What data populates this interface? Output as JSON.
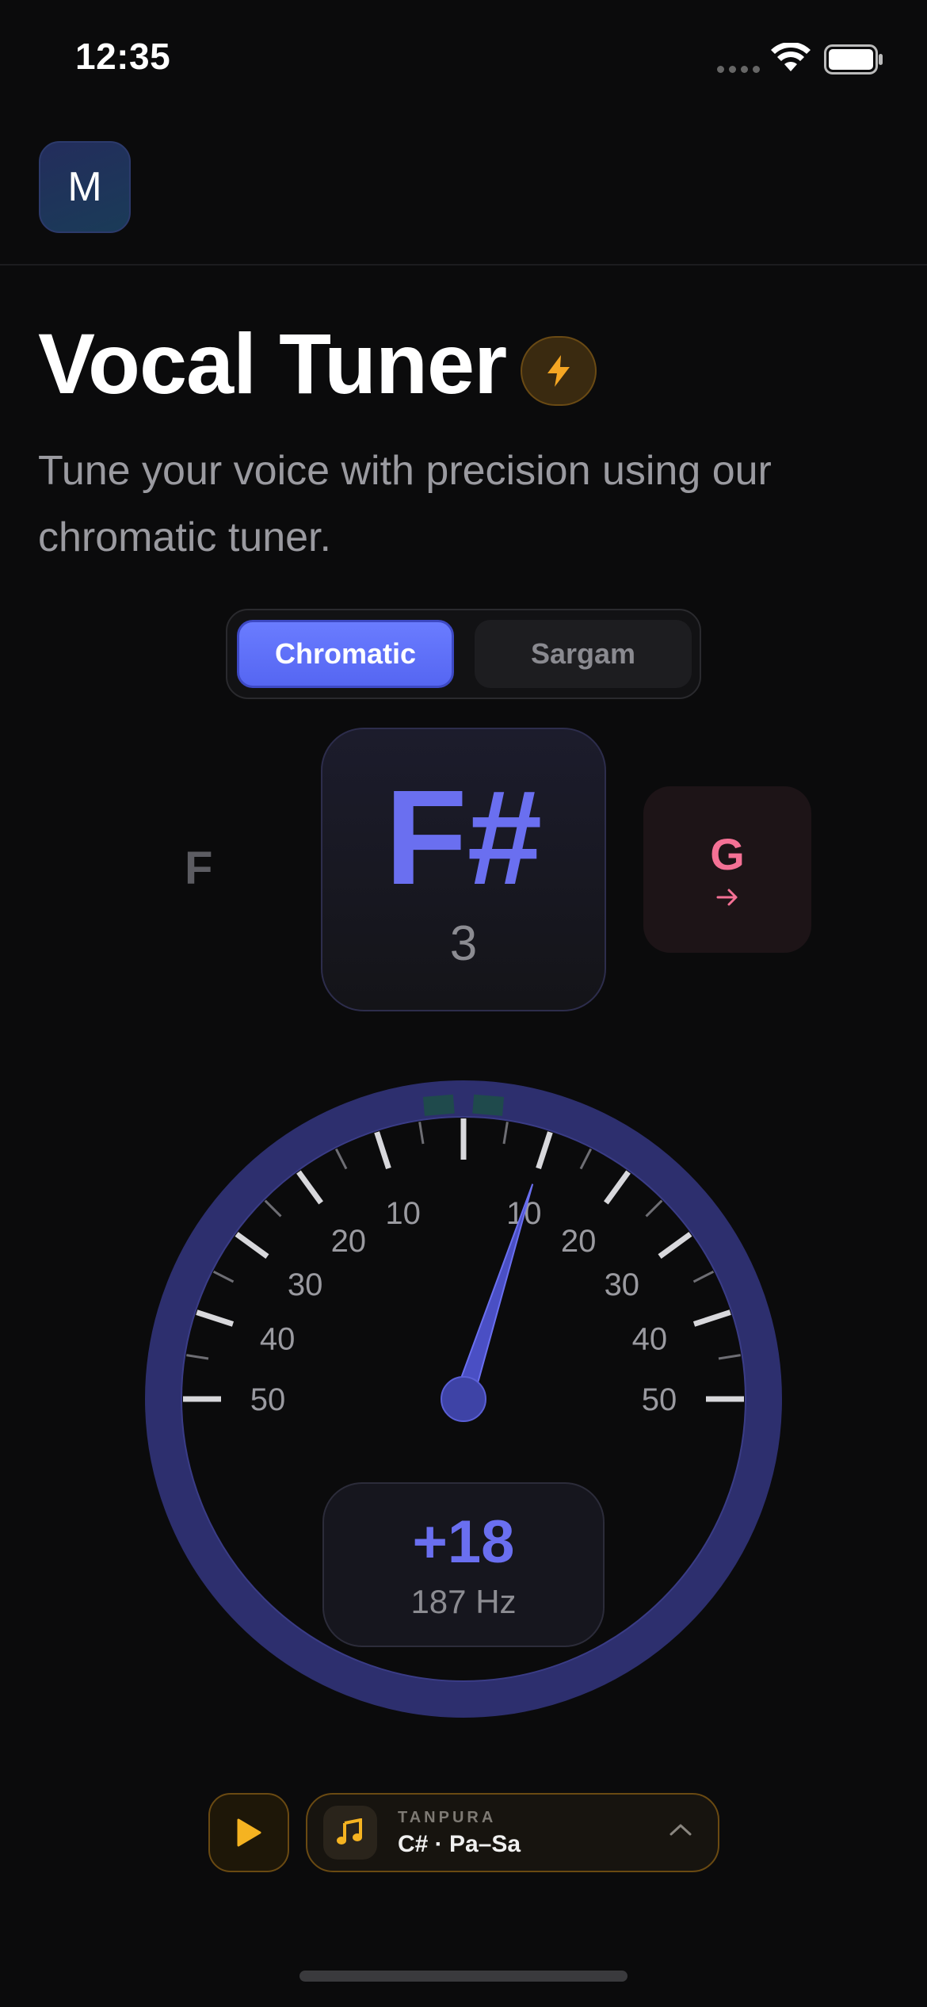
{
  "status_bar": {
    "time": "12:35",
    "icons": [
      "signal-dots-icon",
      "wifi-icon",
      "battery-icon"
    ]
  },
  "header": {
    "avatar_letter": "M"
  },
  "title": {
    "text": "Vocal Tuner",
    "badge_icon": "lightning-icon"
  },
  "subtitle": "Tune your voice with precision using our chromatic tuner.",
  "mode_toggle": {
    "options": [
      "Chromatic",
      "Sargam"
    ],
    "selected": "Chromatic"
  },
  "notes": {
    "previous": "F",
    "current": "F#",
    "current_octave": "3",
    "next": "G",
    "next_arrow": "→"
  },
  "gauge": {
    "scale_labels_left": [
      "10",
      "20",
      "30",
      "40",
      "50"
    ],
    "scale_labels_right": [
      "10",
      "20",
      "30",
      "40",
      "50"
    ],
    "range": [
      -50,
      50
    ],
    "needle_cents": 18
  },
  "readout": {
    "cents": "+18",
    "frequency": "187 Hz"
  },
  "tanpura": {
    "label": "TANPURA",
    "setting": "C# · Pa–Sa"
  },
  "colors": {
    "accent": "#6a6ff0",
    "gauge_ring": "#2d2f6e",
    "next_note": "#f47195",
    "tanpura_accent": "#f5b321",
    "in_tune_marker": "#1f4a4c"
  }
}
